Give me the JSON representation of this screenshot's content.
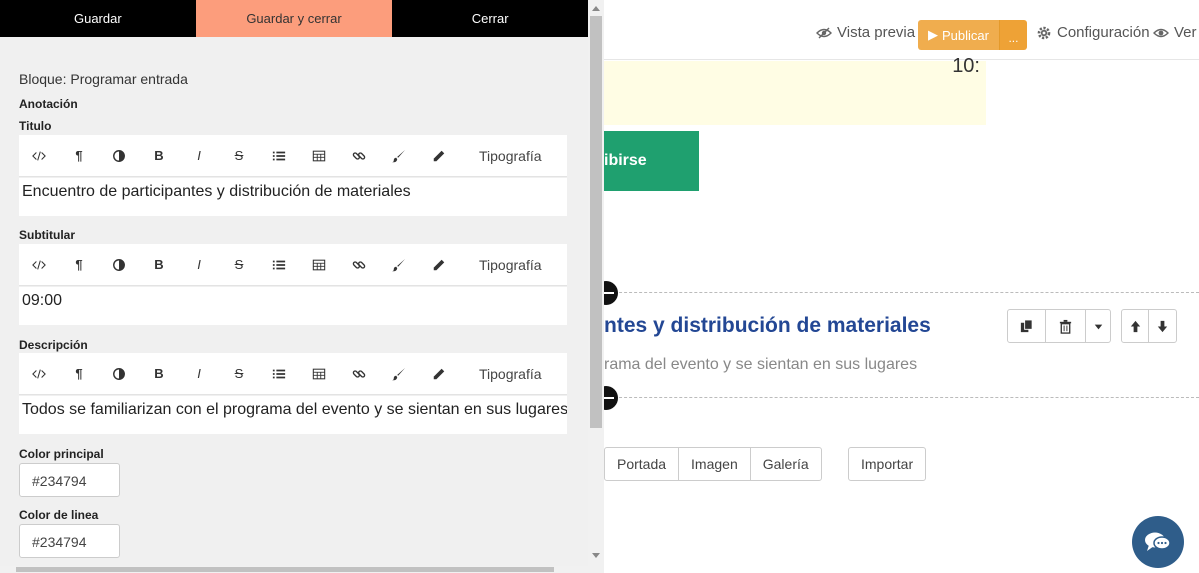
{
  "panel": {
    "actions": {
      "save": "Guardar",
      "save_close": "Guardar y cerrar",
      "close": "Cerrar"
    },
    "block_name": "Bloque: Programar entrada",
    "annotation_label": "Anotación",
    "title_label": "Titulo",
    "title_value": "Encuentro de participantes y distribución de materiales",
    "subtitle_label": "Subtitular",
    "subtitle_value": "09:00",
    "description_label": "Descripción",
    "description_value": "Todos se familiarizan con el programa del evento y se sientan en sus lugares",
    "main_color_label": "Color principal",
    "main_color_value": "#234794",
    "line_color_label": "Color de linea",
    "line_color_value": "#234794",
    "toolbar": {
      "source_icon": "code-icon",
      "typography": "Tipografía",
      "bold": "B",
      "italic": "I",
      "strike": "S"
    }
  },
  "topbar": {
    "preview": "Vista previa",
    "publish": "Publicar",
    "more": "...",
    "settings": "Configuración",
    "view": "Ver"
  },
  "canvas": {
    "yellow_text": "10:",
    "green_button": "ibirse",
    "block_title": "ntes y distribución de materiales",
    "block_subtitle": "rama del evento y se sientan en sus lugares",
    "tabs": [
      "Portada",
      "Imagen",
      "Galería"
    ],
    "import": "Importar"
  },
  "colors": {
    "accent_orange": "#fc9d7c",
    "publish_orange": "#f0ad4e",
    "title_blue": "#234794",
    "green": "#1fa06f"
  }
}
